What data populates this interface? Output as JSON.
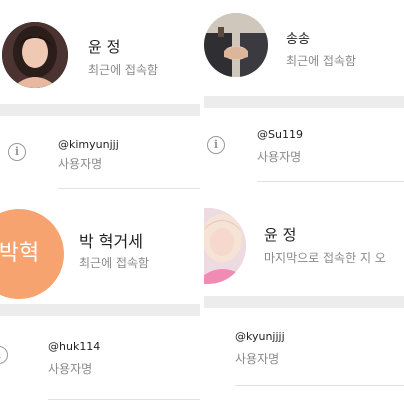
{
  "panels": [
    {
      "profile": {
        "name": "윤 정",
        "status": "최근에 접속함"
      },
      "info": {
        "username": "@kimyunjjj",
        "label": "사용자명"
      }
    },
    {
      "profile": {
        "name": "송송",
        "status": "최근에 접속함"
      },
      "info": {
        "username": "@Su119",
        "label": "사용자명"
      }
    },
    {
      "profile": {
        "name": "박 혁거세",
        "status": "최근에 접속함",
        "initials": "박혁",
        "avatar_color": "#f7a36f"
      },
      "info": {
        "username": "@huk114",
        "label": "사용자명"
      }
    },
    {
      "profile": {
        "name": "윤 정",
        "status": "마지막으로 접속한 지 오"
      },
      "info": {
        "username": "@kyunjjjj",
        "label": "사용자명"
      }
    }
  ],
  "icons": {
    "info": "info-icon",
    "info_glyph": "i"
  }
}
